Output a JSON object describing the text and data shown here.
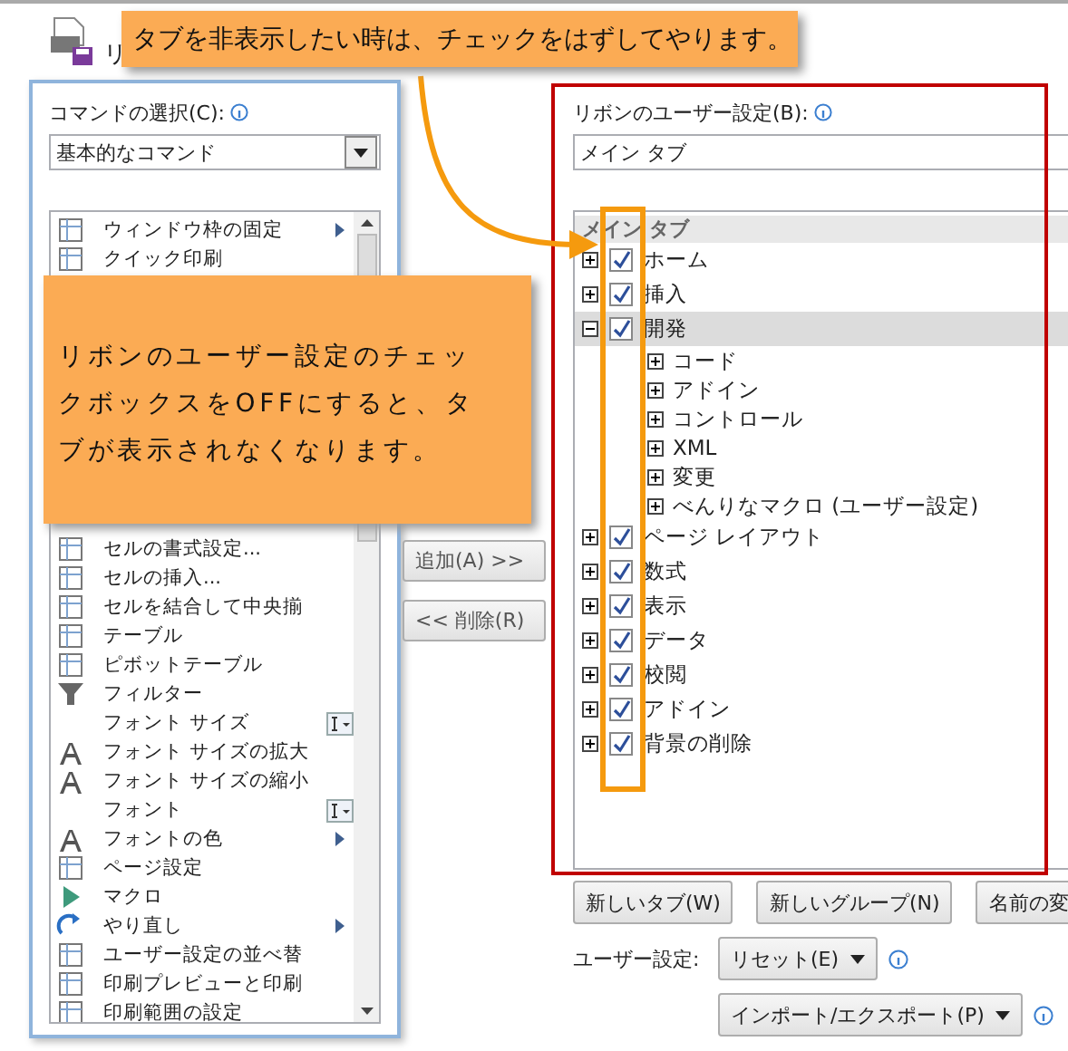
{
  "header": {
    "title": "リ"
  },
  "callouts": [
    {
      "text": "タブを非表示したい時は、チェックをはずしてやります。"
    },
    {
      "text": "リボンのユーザー設定のチェックボックスをOFFにすると、タブが表示されなくなります。"
    }
  ],
  "commands": {
    "label": "コマンドの選択(C):",
    "dropdown": "基本的なコマンド",
    "items": [
      {
        "label": "ウィンドウ枠の固定",
        "kind": "submenu"
      },
      {
        "label": "クイック印刷"
      },
      {
        "label": "セルの書式設定..."
      },
      {
        "label": "セルの挿入..."
      },
      {
        "label": "セルを結合して中央揃"
      },
      {
        "label": "テーブル"
      },
      {
        "label": "ピボットテーブル"
      },
      {
        "label": "フィルター"
      },
      {
        "label": "フォント サイズ",
        "kind": "combo"
      },
      {
        "label": "フォント サイズの拡大"
      },
      {
        "label": "フォント サイズの縮小"
      },
      {
        "label": "フォント",
        "kind": "combo"
      },
      {
        "label": "フォントの色",
        "kind": "submenu"
      },
      {
        "label": "ページ設定"
      },
      {
        "label": "マクロ"
      },
      {
        "label": "やり直し",
        "kind": "submenu"
      },
      {
        "label": "ユーザー設定の並べ替"
      },
      {
        "label": "印刷プレビューと印刷"
      },
      {
        "label": "印刷範囲の設定"
      }
    ]
  },
  "transfer_buttons": [
    "追加(A) >>",
    "<< 削除(R)"
  ],
  "ribbon": {
    "label": "リボンのユーザー設定(B):",
    "dropdown": "メイン タブ",
    "tree_header": "メイン タブ",
    "tabs": [
      {
        "label": "ホーム",
        "checked": true,
        "expanded": false,
        "selected": false
      },
      {
        "label": "挿入",
        "checked": true,
        "expanded": false,
        "selected": false
      },
      {
        "label": "開発",
        "checked": true,
        "expanded": true,
        "selected": true,
        "children": [
          {
            "label": "コード",
            "expanded": false
          },
          {
            "label": "アドイン",
            "expanded": false
          },
          {
            "label": "コントロール",
            "expanded": false
          },
          {
            "label": "XML",
            "expanded": false
          },
          {
            "label": "変更",
            "expanded": false
          },
          {
            "label": "べんりなマクロ (ユーザー設定)",
            "expanded": false
          }
        ]
      },
      {
        "label": "ページ レイアウト",
        "checked": true,
        "expanded": false,
        "selected": false
      },
      {
        "label": "数式",
        "checked": true,
        "expanded": false,
        "selected": false
      },
      {
        "label": "表示",
        "checked": true,
        "expanded": false,
        "selected": false
      },
      {
        "label": "データ",
        "checked": true,
        "expanded": false,
        "selected": false
      },
      {
        "label": "校閲",
        "checked": true,
        "expanded": false,
        "selected": false
      },
      {
        "label": "アドイン",
        "checked": true,
        "expanded": false,
        "selected": false
      },
      {
        "label": "背景の削除",
        "checked": true,
        "expanded": false,
        "selected": false
      }
    ]
  },
  "tab_buttons": [
    "新しいタブ(W)",
    "新しいグループ(N)",
    "名前の変"
  ],
  "customize": {
    "label": "ユーザー設定:",
    "reset": "リセット(E)",
    "import_export": "インポート/エクスポート(P)"
  }
}
